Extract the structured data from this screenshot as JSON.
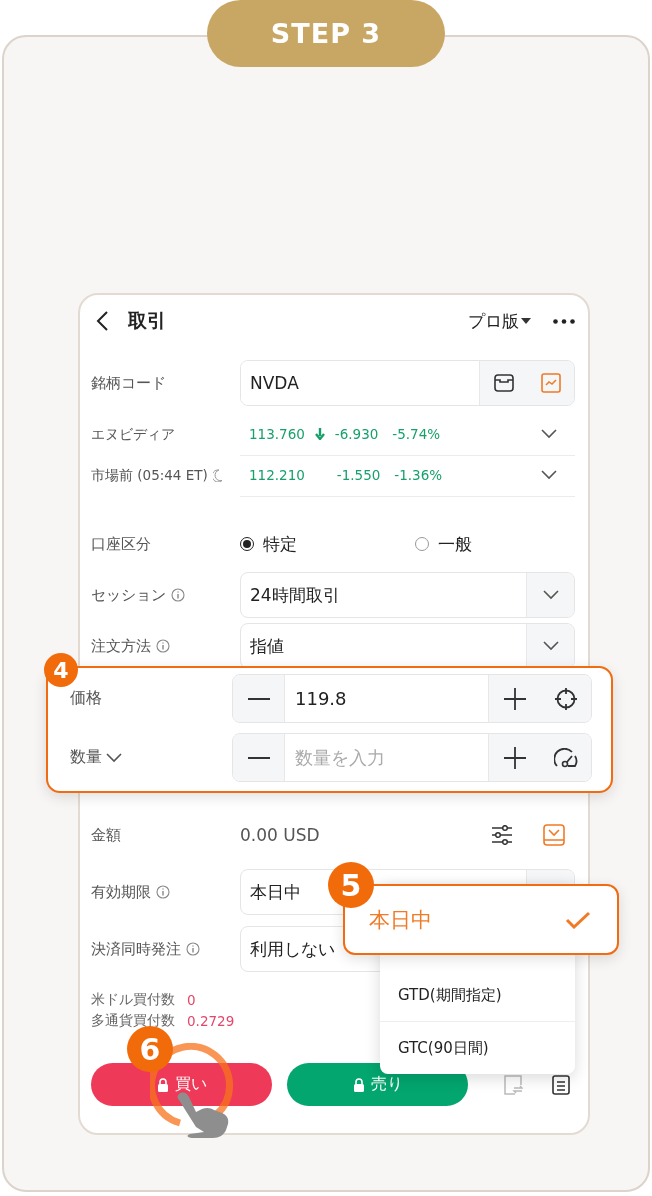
{
  "step": {
    "label": "STEP 3"
  },
  "header": {
    "title": "取引",
    "edition": "プロ版"
  },
  "symbol": {
    "label": "銘柄コード",
    "value": "NVDA"
  },
  "quotes": [
    {
      "name": "エヌビディア",
      "kind": "regular",
      "price": "113.760",
      "arrow": true,
      "change": "-6.930",
      "percent": "-5.74%"
    },
    {
      "name": "市場前 (05:44 ET)",
      "kind": "premarket",
      "price": "112.210",
      "arrow": false,
      "change": "-1.550",
      "percent": "-1.36%"
    }
  ],
  "account": {
    "label": "口座区分",
    "options": [
      {
        "label": "特定",
        "selected": true
      },
      {
        "label": "一般",
        "selected": false
      }
    ]
  },
  "session": {
    "label": "セッション",
    "info": true,
    "value": "24時間取引"
  },
  "order_type": {
    "label": "注文方法",
    "info": true,
    "value": "指値"
  },
  "amount": {
    "label": "金額",
    "value": "0.00 USD"
  },
  "validity": {
    "label": "有効期限",
    "info": true,
    "value": "本日中"
  },
  "settlement": {
    "label": "決済同時発注",
    "info": true,
    "value": "利用しない"
  },
  "buying_power": [
    {
      "label": "米ドル買付数",
      "value": "0"
    },
    {
      "label": "多通貨買付数",
      "value": "0.2729"
    }
  ],
  "actions": [
    {
      "label": "買い",
      "kind": "buy"
    },
    {
      "label": "売り",
      "kind": "sell"
    }
  ],
  "highlight": {
    "badge": "4",
    "rows": [
      {
        "label": "価格",
        "kind": "price",
        "value": "119.8"
      },
      {
        "label": "数量",
        "kind": "quantity",
        "placeholder": "数量を入力"
      }
    ]
  },
  "dropdown": {
    "badge": "5",
    "options": [
      {
        "label": "本日中",
        "selected": true
      },
      {
        "label": "GTD(期間指定)",
        "selected": false
      },
      {
        "label": "GTC(90日間)",
        "selected": false
      }
    ]
  },
  "tap_hint": {
    "badge": "6"
  }
}
